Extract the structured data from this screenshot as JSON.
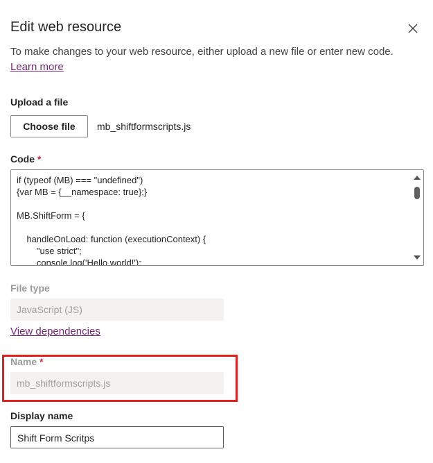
{
  "panel": {
    "title": "Edit web resource",
    "description": "To make changes to your web resource, either upload a new file or enter new code.",
    "learn_more": "Learn more"
  },
  "upload": {
    "label": "Upload a file",
    "button": "Choose file",
    "filename": "mb_shiftformscripts.js"
  },
  "code": {
    "label": "Code",
    "required_mark": "*",
    "lines": [
      "if (typeof (MB) === \"undefined\")",
      "{var MB = {__namespace: true};}",
      "",
      "MB.ShiftForm = {",
      "",
      "    handleOnLoad: function (executionContext) {",
      "        \"use strict\";",
      "        console.log('Hello world!');"
    ]
  },
  "file_type": {
    "label": "File type",
    "value": "JavaScript (JS)"
  },
  "view_dependencies": "View dependencies",
  "name": {
    "label": "Name",
    "required_mark": "*",
    "value": "mb_shiftformscripts.js"
  },
  "display_name": {
    "label": "Display name",
    "value": "Shift Form Scritps"
  },
  "colors": {
    "link": "#742774",
    "required": "#c4314b",
    "highlight_border": "#e32020",
    "disabled_bg": "#f3f2f1"
  }
}
